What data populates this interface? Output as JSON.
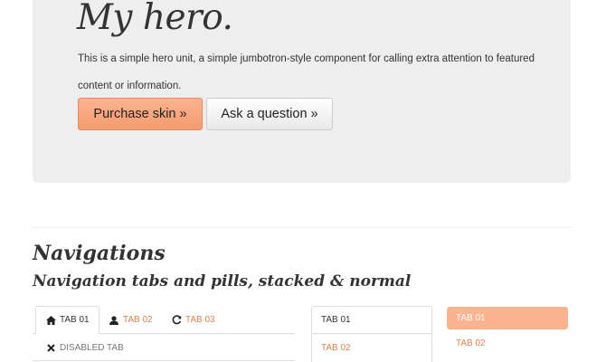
{
  "hero": {
    "title": "My hero.",
    "text": "This is a simple hero unit, a simple jumbotron-style component for calling extra attention to featured content or information.",
    "primary_button": "Purchase skin »",
    "secondary_button": "Ask a question »"
  },
  "navigations": {
    "title": "Navigations",
    "subtitle": "Navigation tabs and pills, stacked & normal",
    "tabs": [
      {
        "label": "TAB 01",
        "icon": "home-icon",
        "state": "active"
      },
      {
        "label": "TAB 02",
        "icon": "user-icon",
        "state": "link"
      },
      {
        "label": "TAB 03",
        "icon": "refresh-icon",
        "state": "link"
      },
      {
        "label": "DISABLED TAB",
        "icon": "close-icon",
        "state": "disabled"
      }
    ],
    "stacked_tabs": [
      {
        "label": "TAB 01",
        "state": "active"
      },
      {
        "label": "TAB 02",
        "state": "link"
      }
    ],
    "stacked_pills": [
      {
        "label": "TAB 01",
        "state": "active"
      },
      {
        "label": "TAB 02",
        "state": "link"
      }
    ]
  },
  "colors": {
    "accent": "#f59a6e",
    "link": "#e8804a",
    "hero_bg": "#eeeeee"
  }
}
